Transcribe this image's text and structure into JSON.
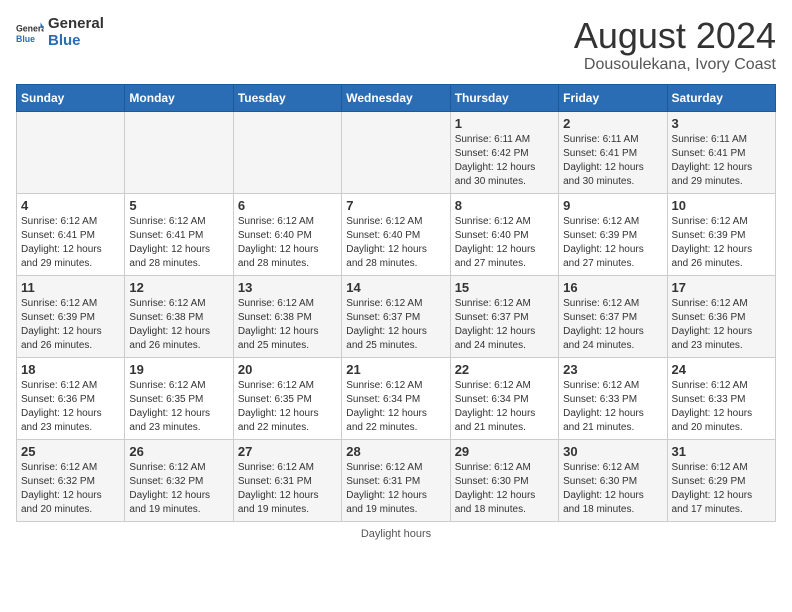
{
  "logo": {
    "general": "General",
    "blue": "Blue"
  },
  "header": {
    "title": "August 2024",
    "subtitle": "Dousoulekana, Ivory Coast"
  },
  "days_of_week": [
    "Sunday",
    "Monday",
    "Tuesday",
    "Wednesday",
    "Thursday",
    "Friday",
    "Saturday"
  ],
  "weeks": [
    [
      {
        "day": "",
        "sunrise": "",
        "sunset": "",
        "daylight": ""
      },
      {
        "day": "",
        "sunrise": "",
        "sunset": "",
        "daylight": ""
      },
      {
        "day": "",
        "sunrise": "",
        "sunset": "",
        "daylight": ""
      },
      {
        "day": "",
        "sunrise": "",
        "sunset": "",
        "daylight": ""
      },
      {
        "day": "1",
        "sunrise": "Sunrise: 6:11 AM",
        "sunset": "Sunset: 6:42 PM",
        "daylight": "Daylight: 12 hours and 30 minutes."
      },
      {
        "day": "2",
        "sunrise": "Sunrise: 6:11 AM",
        "sunset": "Sunset: 6:41 PM",
        "daylight": "Daylight: 12 hours and 30 minutes."
      },
      {
        "day": "3",
        "sunrise": "Sunrise: 6:11 AM",
        "sunset": "Sunset: 6:41 PM",
        "daylight": "Daylight: 12 hours and 29 minutes."
      }
    ],
    [
      {
        "day": "4",
        "sunrise": "Sunrise: 6:12 AM",
        "sunset": "Sunset: 6:41 PM",
        "daylight": "Daylight: 12 hours and 29 minutes."
      },
      {
        "day": "5",
        "sunrise": "Sunrise: 6:12 AM",
        "sunset": "Sunset: 6:41 PM",
        "daylight": "Daylight: 12 hours and 28 minutes."
      },
      {
        "day": "6",
        "sunrise": "Sunrise: 6:12 AM",
        "sunset": "Sunset: 6:40 PM",
        "daylight": "Daylight: 12 hours and 28 minutes."
      },
      {
        "day": "7",
        "sunrise": "Sunrise: 6:12 AM",
        "sunset": "Sunset: 6:40 PM",
        "daylight": "Daylight: 12 hours and 28 minutes."
      },
      {
        "day": "8",
        "sunrise": "Sunrise: 6:12 AM",
        "sunset": "Sunset: 6:40 PM",
        "daylight": "Daylight: 12 hours and 27 minutes."
      },
      {
        "day": "9",
        "sunrise": "Sunrise: 6:12 AM",
        "sunset": "Sunset: 6:39 PM",
        "daylight": "Daylight: 12 hours and 27 minutes."
      },
      {
        "day": "10",
        "sunrise": "Sunrise: 6:12 AM",
        "sunset": "Sunset: 6:39 PM",
        "daylight": "Daylight: 12 hours and 26 minutes."
      }
    ],
    [
      {
        "day": "11",
        "sunrise": "Sunrise: 6:12 AM",
        "sunset": "Sunset: 6:39 PM",
        "daylight": "Daylight: 12 hours and 26 minutes."
      },
      {
        "day": "12",
        "sunrise": "Sunrise: 6:12 AM",
        "sunset": "Sunset: 6:38 PM",
        "daylight": "Daylight: 12 hours and 26 minutes."
      },
      {
        "day": "13",
        "sunrise": "Sunrise: 6:12 AM",
        "sunset": "Sunset: 6:38 PM",
        "daylight": "Daylight: 12 hours and 25 minutes."
      },
      {
        "day": "14",
        "sunrise": "Sunrise: 6:12 AM",
        "sunset": "Sunset: 6:37 PM",
        "daylight": "Daylight: 12 hours and 25 minutes."
      },
      {
        "day": "15",
        "sunrise": "Sunrise: 6:12 AM",
        "sunset": "Sunset: 6:37 PM",
        "daylight": "Daylight: 12 hours and 24 minutes."
      },
      {
        "day": "16",
        "sunrise": "Sunrise: 6:12 AM",
        "sunset": "Sunset: 6:37 PM",
        "daylight": "Daylight: 12 hours and 24 minutes."
      },
      {
        "day": "17",
        "sunrise": "Sunrise: 6:12 AM",
        "sunset": "Sunset: 6:36 PM",
        "daylight": "Daylight: 12 hours and 23 minutes."
      }
    ],
    [
      {
        "day": "18",
        "sunrise": "Sunrise: 6:12 AM",
        "sunset": "Sunset: 6:36 PM",
        "daylight": "Daylight: 12 hours and 23 minutes."
      },
      {
        "day": "19",
        "sunrise": "Sunrise: 6:12 AM",
        "sunset": "Sunset: 6:35 PM",
        "daylight": "Daylight: 12 hours and 23 minutes."
      },
      {
        "day": "20",
        "sunrise": "Sunrise: 6:12 AM",
        "sunset": "Sunset: 6:35 PM",
        "daylight": "Daylight: 12 hours and 22 minutes."
      },
      {
        "day": "21",
        "sunrise": "Sunrise: 6:12 AM",
        "sunset": "Sunset: 6:34 PM",
        "daylight": "Daylight: 12 hours and 22 minutes."
      },
      {
        "day": "22",
        "sunrise": "Sunrise: 6:12 AM",
        "sunset": "Sunset: 6:34 PM",
        "daylight": "Daylight: 12 hours and 21 minutes."
      },
      {
        "day": "23",
        "sunrise": "Sunrise: 6:12 AM",
        "sunset": "Sunset: 6:33 PM",
        "daylight": "Daylight: 12 hours and 21 minutes."
      },
      {
        "day": "24",
        "sunrise": "Sunrise: 6:12 AM",
        "sunset": "Sunset: 6:33 PM",
        "daylight": "Daylight: 12 hours and 20 minutes."
      }
    ],
    [
      {
        "day": "25",
        "sunrise": "Sunrise: 6:12 AM",
        "sunset": "Sunset: 6:32 PM",
        "daylight": "Daylight: 12 hours and 20 minutes."
      },
      {
        "day": "26",
        "sunrise": "Sunrise: 6:12 AM",
        "sunset": "Sunset: 6:32 PM",
        "daylight": "Daylight: 12 hours and 19 minutes."
      },
      {
        "day": "27",
        "sunrise": "Sunrise: 6:12 AM",
        "sunset": "Sunset: 6:31 PM",
        "daylight": "Daylight: 12 hours and 19 minutes."
      },
      {
        "day": "28",
        "sunrise": "Sunrise: 6:12 AM",
        "sunset": "Sunset: 6:31 PM",
        "daylight": "Daylight: 12 hours and 19 minutes."
      },
      {
        "day": "29",
        "sunrise": "Sunrise: 6:12 AM",
        "sunset": "Sunset: 6:30 PM",
        "daylight": "Daylight: 12 hours and 18 minutes."
      },
      {
        "day": "30",
        "sunrise": "Sunrise: 6:12 AM",
        "sunset": "Sunset: 6:30 PM",
        "daylight": "Daylight: 12 hours and 18 minutes."
      },
      {
        "day": "31",
        "sunrise": "Sunrise: 6:12 AM",
        "sunset": "Sunset: 6:29 PM",
        "daylight": "Daylight: 12 hours and 17 minutes."
      }
    ]
  ],
  "footer": "Daylight hours"
}
